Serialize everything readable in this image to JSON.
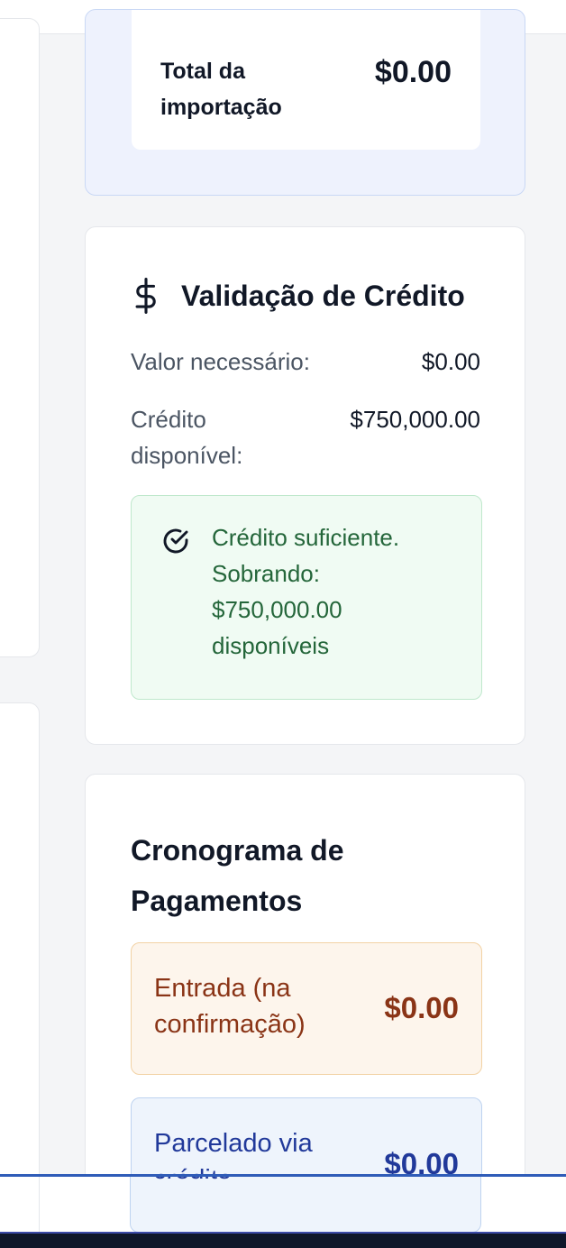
{
  "summary": {
    "total_label": "Total da importação",
    "total_value": "$0.00"
  },
  "credit": {
    "title": "Validação de Crédito",
    "title_icon": "dollar-icon",
    "required_label": "Valor necessário:",
    "required_value": "$0.00",
    "available_label": "Crédito disponível:",
    "available_value": "$750,000.00",
    "status_icon": "check-circle-icon",
    "status_text": "Crédito suficiente. Sobrando: $750,000.00 disponíveis",
    "status_color": "#24663a"
  },
  "schedule": {
    "title": "Cronograma de Pagamentos",
    "entrada_label": "Entrada (na confirmação)",
    "entrada_value": "$0.00",
    "parcelado_label": "Parcelado via crédito",
    "parcelado_value": "$0.00"
  },
  "colors": {
    "accent_blue": "#2f5cb8",
    "entrada": "#8a3416",
    "parcelado": "#21399a"
  }
}
